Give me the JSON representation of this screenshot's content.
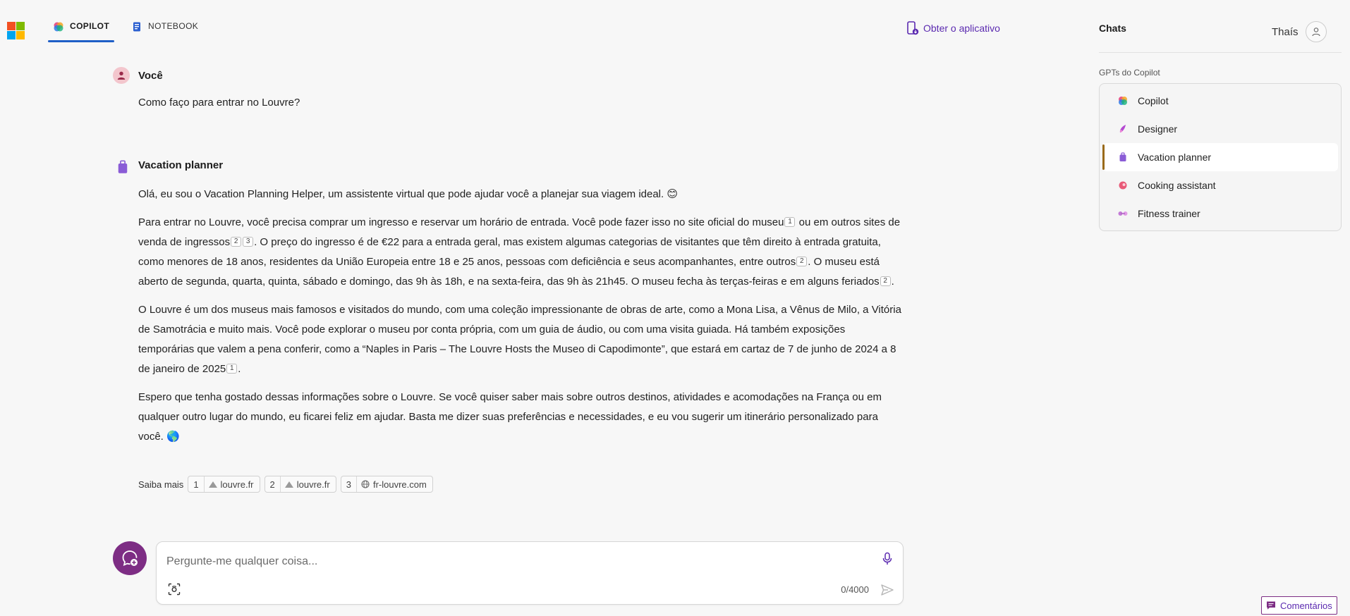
{
  "header": {
    "tabs": [
      {
        "label": "COPILOT",
        "active": true
      },
      {
        "label": "NOTEBOOK",
        "active": false
      }
    ],
    "get_app": "Obter o aplicativo"
  },
  "sidebar": {
    "title": "Chats",
    "user_name": "Thaís",
    "section_label": "GPTs do Copilot",
    "items": [
      {
        "label": "Copilot",
        "icon": "copilot-icon"
      },
      {
        "label": "Designer",
        "icon": "designer-icon"
      },
      {
        "label": "Vacation planner",
        "icon": "vacation-planner-icon",
        "active": true
      },
      {
        "label": "Cooking assistant",
        "icon": "cooking-assistant-icon"
      },
      {
        "label": "Fitness trainer",
        "icon": "fitness-trainer-icon"
      }
    ]
  },
  "conversation": {
    "user_author": "Você",
    "user_message": "Como faço para entrar no Louvre?",
    "bot_author": "Vacation planner",
    "p1": "Olá, eu sou o Vacation Planning Helper, um assistente virtual que pode ajudar você a planejar sua viagem ideal. 😊",
    "p2": {
      "a": "Para entrar no Louvre, você precisa comprar um ingresso e reservar um horário de entrada. Você pode fazer isso no site oficial do museu",
      "c1": "1",
      "b": " ou em outros sites de venda de ingressos",
      "c2": "2",
      "c3": "3",
      "c": ". O preço do ingresso é de €22 para a entrada geral, mas existem algumas categorias de visitantes que têm direito à entrada gratuita, como menores de 18 anos, residentes da União Europeia entre 18 e 25 anos, pessoas com deficiência e seus acompanhantes, entre outros",
      "c4": "2",
      "d": ". O museu está aberto de segunda, quarta, quinta, sábado e domingo, das 9h às 18h, e na sexta-feira, das 9h às 21h45. O museu fecha às terças-feiras e em alguns feriados",
      "c5": "2",
      "e": "."
    },
    "p3": {
      "a": "O Louvre é um dos museus mais famosos e visitados do mundo, com uma coleção impressionante de obras de arte, como a Mona Lisa, a Vênus de Milo, a Vitória de Samotrácia e muito mais. Você pode explorar o museu por conta própria, com um guia de áudio, ou com uma visita guiada. Há também exposições temporárias que valem a pena conferir, como a “Naples in Paris – The Louvre Hosts the Museo di Capodimonte”, que estará em cartaz de 7 de junho de 2024 a 8 de janeiro de 2025",
      "c1": "1",
      "b": "."
    },
    "p4": "Espero que tenha gostado dessas informações sobre o Louvre. Se você quiser saber mais sobre outros destinos, atividades e acomodações na França ou em qualquer outro lugar do mundo, eu ficarei feliz em ajudar. Basta me dizer suas preferências e necessidades, e eu vou sugerir um itinerário personalizado para você. 🌎",
    "learn_more_label": "Saiba mais",
    "sources": [
      {
        "num": "1",
        "domain": "louvre.fr",
        "icon": "louvre-triangle-icon"
      },
      {
        "num": "2",
        "domain": "louvre.fr",
        "icon": "louvre-triangle-icon"
      },
      {
        "num": "3",
        "domain": "fr-louvre.com",
        "icon": "globe-icon"
      }
    ]
  },
  "composer": {
    "placeholder": "Pergunte-me qualquer coisa...",
    "value": "",
    "counter": "0/4000"
  },
  "feedback_label": "Comentários",
  "colors": {
    "accent": "#1f5fc7",
    "brand_purple": "#7d2d84",
    "link_purple": "#5b2ab0"
  }
}
